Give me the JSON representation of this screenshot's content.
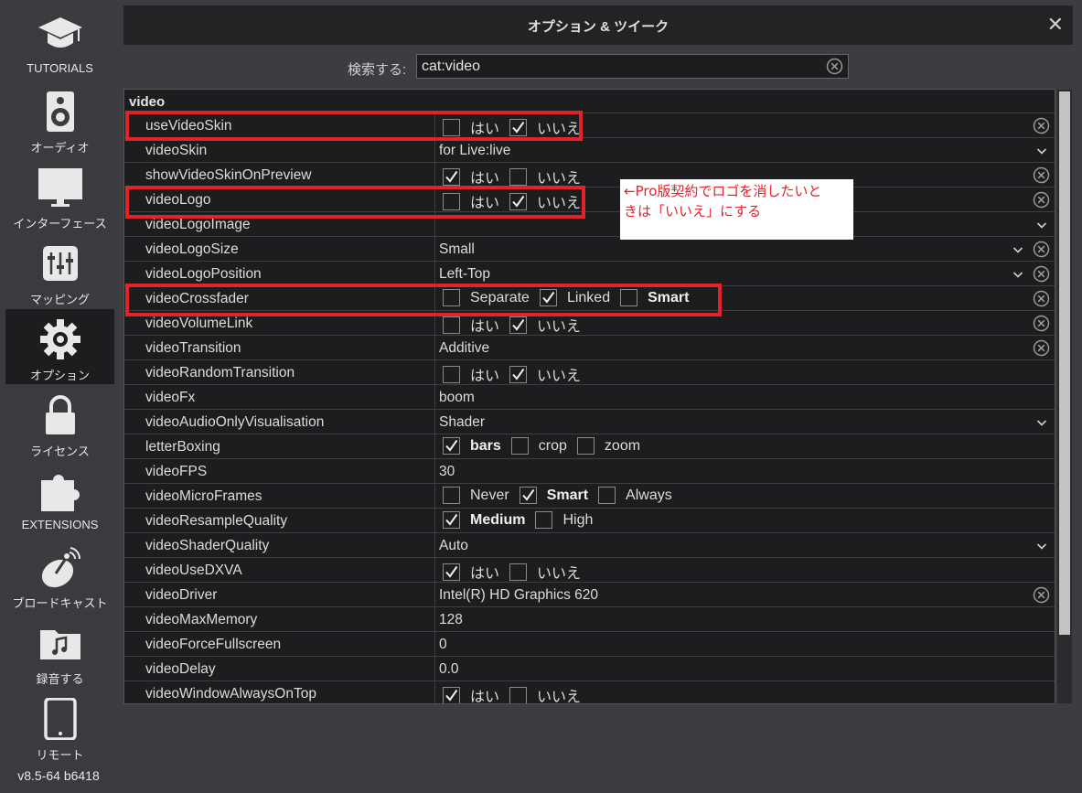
{
  "sidebar": {
    "items": [
      {
        "label": "TUTORIALS",
        "icon": "graduation-cap-icon",
        "active": false
      },
      {
        "label": "オーディオ",
        "icon": "speaker-icon",
        "active": false
      },
      {
        "label": "インターフェース",
        "icon": "monitor-icon",
        "active": false
      },
      {
        "label": "マッピング",
        "icon": "sliders-icon",
        "active": false
      },
      {
        "label": "オプション",
        "icon": "gear-icon",
        "active": true
      },
      {
        "label": "ライセンス",
        "icon": "lock-icon",
        "active": false
      },
      {
        "label": "EXTENSIONS",
        "icon": "puzzle-icon",
        "active": false
      },
      {
        "label": "ブロードキャスト",
        "icon": "satellite-dish-icon",
        "active": false
      },
      {
        "label": "録音する",
        "icon": "music-folder-icon",
        "active": false
      },
      {
        "label": "リモート",
        "icon": "tablet-icon",
        "active": false
      }
    ],
    "version": "v8.5-64 b6418"
  },
  "dialog": {
    "title": "オプション & ツイーク",
    "search_label": "検索する:",
    "search_value": "cat:video"
  },
  "settings": {
    "category": "video",
    "rows": [
      {
        "name": "useVideoSkin",
        "type": "options",
        "options": [
          {
            "label": "はい",
            "checked": false
          },
          {
            "label": "いいえ",
            "checked": true
          }
        ],
        "clear": true
      },
      {
        "name": "videoSkin",
        "type": "select",
        "value": "for Live:live",
        "clear": false
      },
      {
        "name": "showVideoSkinOnPreview",
        "type": "options",
        "options": [
          {
            "label": "はい",
            "checked": true
          },
          {
            "label": "いいえ",
            "checked": false
          }
        ],
        "clear": true
      },
      {
        "name": "videoLogo",
        "type": "options",
        "options": [
          {
            "label": "はい",
            "checked": false
          },
          {
            "label": "いいえ",
            "checked": true
          }
        ],
        "clear": true
      },
      {
        "name": "videoLogoImage",
        "type": "select",
        "value": "",
        "clear": false
      },
      {
        "name": "videoLogoSize",
        "type": "select",
        "value": "Small",
        "clear": true
      },
      {
        "name": "videoLogoPosition",
        "type": "select",
        "value": "Left-Top",
        "clear": true
      },
      {
        "name": "videoCrossfader",
        "type": "options",
        "options": [
          {
            "label": "Separate",
            "checked": false
          },
          {
            "label": "Linked",
            "checked": true
          },
          {
            "label": "Smart",
            "checked": false,
            "bold": true
          }
        ],
        "clear": true
      },
      {
        "name": "videoVolumeLink",
        "type": "options",
        "options": [
          {
            "label": "はい",
            "checked": false
          },
          {
            "label": "いいえ",
            "checked": true
          }
        ],
        "clear": true
      },
      {
        "name": "videoTransition",
        "type": "text",
        "value": "Additive",
        "clear": true
      },
      {
        "name": "videoRandomTransition",
        "type": "options",
        "options": [
          {
            "label": "はい",
            "checked": false
          },
          {
            "label": "いいえ",
            "checked": true
          }
        ],
        "clear": false
      },
      {
        "name": "videoFx",
        "type": "text",
        "value": "boom",
        "clear": false
      },
      {
        "name": "videoAudioOnlyVisualisation",
        "type": "select",
        "value": "Shader",
        "clear": false
      },
      {
        "name": "letterBoxing",
        "type": "options",
        "options": [
          {
            "label": "bars",
            "checked": true,
            "bold": true
          },
          {
            "label": "crop",
            "checked": false
          },
          {
            "label": "zoom",
            "checked": false
          }
        ],
        "clear": false
      },
      {
        "name": "videoFPS",
        "type": "text",
        "value": "30",
        "clear": false
      },
      {
        "name": "videoMicroFrames",
        "type": "options",
        "options": [
          {
            "label": "Never",
            "checked": false
          },
          {
            "label": "Smart",
            "checked": true,
            "bold": true
          },
          {
            "label": "Always",
            "checked": false
          }
        ],
        "clear": false
      },
      {
        "name": "videoResampleQuality",
        "type": "options",
        "options": [
          {
            "label": "Medium",
            "checked": true,
            "bold": true
          },
          {
            "label": "High",
            "checked": false
          }
        ],
        "clear": false
      },
      {
        "name": "videoShaderQuality",
        "type": "select",
        "value": "Auto",
        "clear": false
      },
      {
        "name": "videoUseDXVA",
        "type": "options",
        "options": [
          {
            "label": "はい",
            "checked": true
          },
          {
            "label": "いいえ",
            "checked": false
          }
        ],
        "clear": false
      },
      {
        "name": "videoDriver",
        "type": "text",
        "value": "Intel(R) HD Graphics 620",
        "clear": true
      },
      {
        "name": "videoMaxMemory",
        "type": "text",
        "value": "128",
        "clear": false
      },
      {
        "name": "videoForceFullscreen",
        "type": "text",
        "value": "0",
        "clear": false
      },
      {
        "name": "videoDelay",
        "type": "text",
        "value": "0.0",
        "clear": false
      },
      {
        "name": "videoWindowAlwaysOnTop",
        "type": "options",
        "options": [
          {
            "label": "はい",
            "checked": true
          },
          {
            "label": "いいえ",
            "checked": false
          }
        ],
        "clear": false
      }
    ]
  },
  "annotation": {
    "text_line1": "←Pro版契約でロゴを消したいと",
    "text_line2": "きは「いいえ」にする",
    "color": "#e2232a"
  }
}
